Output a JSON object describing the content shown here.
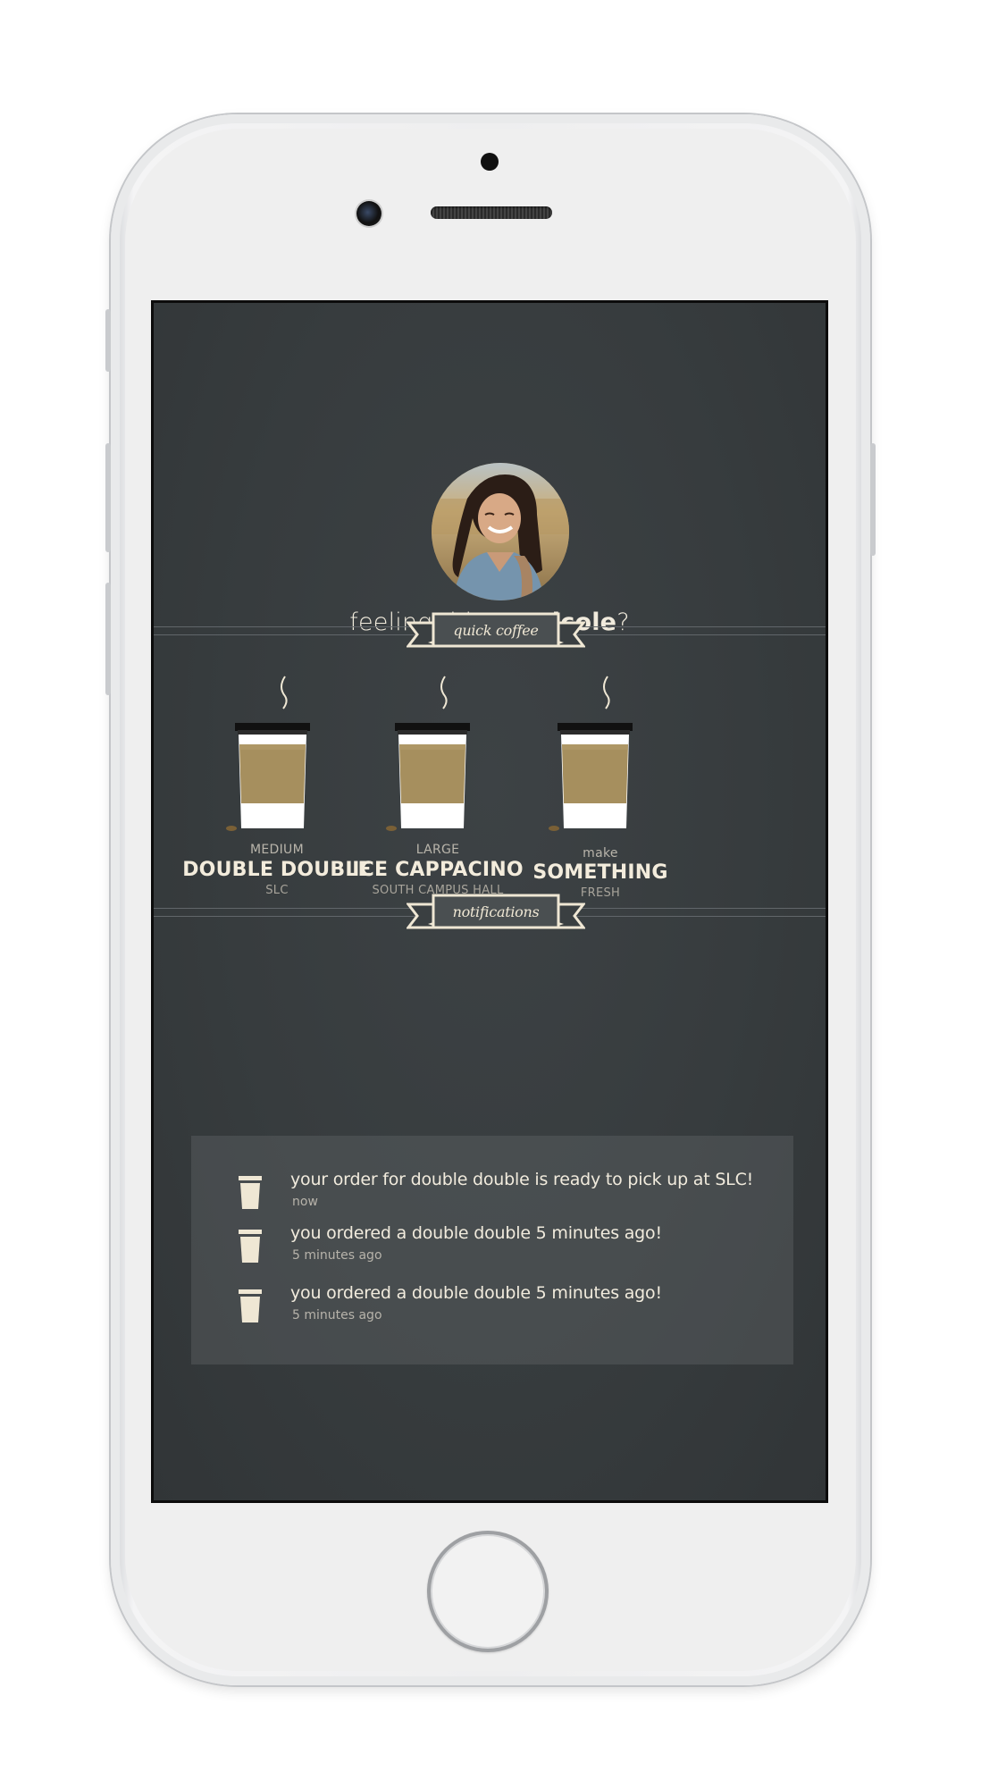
{
  "greeting": {
    "prefix": "feeling thirsty, ",
    "name": "nicole",
    "suffix": "?"
  },
  "sections": {
    "quick_coffee": "quick coffee",
    "notifications": "notifications"
  },
  "quick_coffee": [
    {
      "size": "MEDIUM",
      "name": "DOUBLE DOUBLE",
      "location": "SLC"
    },
    {
      "size": "LARGE",
      "name": "ICE CAPPACINO",
      "location": "SOUTH CAMPUS HALL"
    },
    {
      "size": "make",
      "name": "SOMETHING",
      "location": "FRESH"
    }
  ],
  "notifications": [
    {
      "text": "your order for double double is ready to pick up at SLC!",
      "time": "now"
    },
    {
      "text": "you ordered a double double 5 minutes ago!",
      "time": "5 minutes ago"
    },
    {
      "text": "you ordered a double double 5 minutes ago!",
      "time": "5 minutes ago"
    }
  ],
  "colors": {
    "screen_bg": "#373c3e",
    "cream": "#efe7d4",
    "cup_sleeve": "#a68f5e",
    "cup_lid": "#111111"
  },
  "icons": {
    "cup": "coffee-cup-icon",
    "steam": "steam-icon",
    "banner": "ribbon-banner"
  }
}
